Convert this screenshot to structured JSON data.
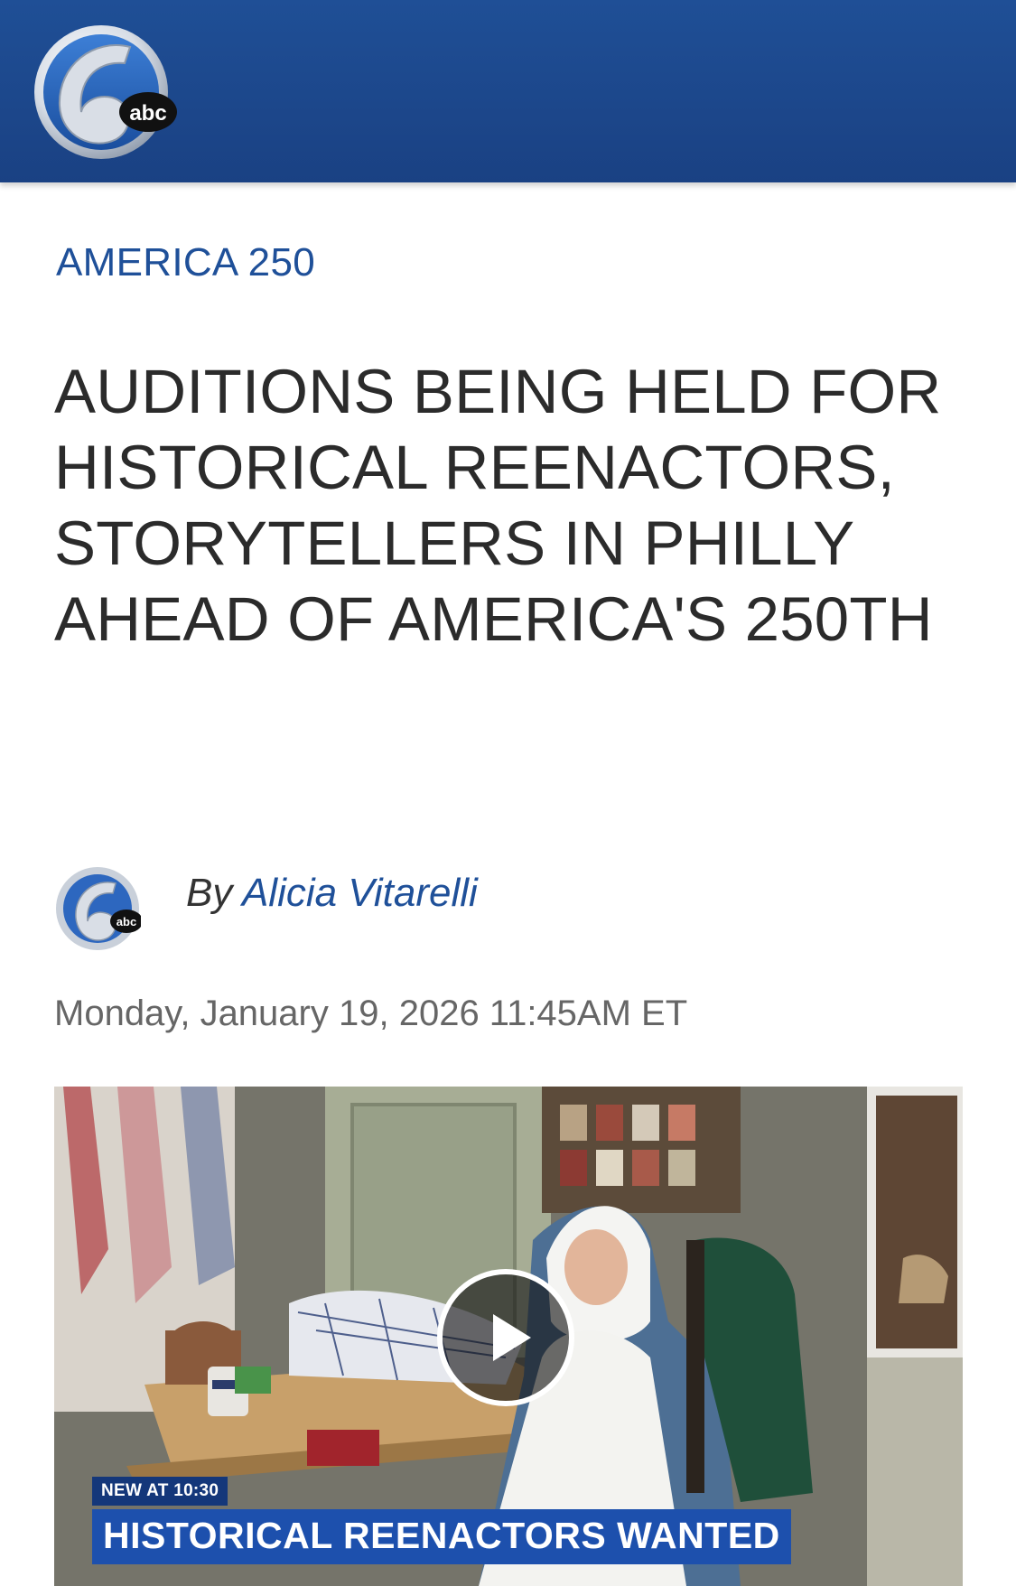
{
  "header": {
    "logo_text": "abc",
    "logo_number": "6"
  },
  "article": {
    "category": "AMERICA 250",
    "headline": "AUDITIONS BEING HELD FOR HISTORICAL REENACTORS, STORYTELLERS IN PHILLY AHEAD OF AMERICA'S 250TH",
    "byline_prefix": "By",
    "author": "Alicia Vitarelli",
    "timestamp": "Monday, January 19, 2026 11:45AM ET"
  },
  "video": {
    "tag": "NEW AT 10:30",
    "title": "HISTORICAL REENACTORS WANTED",
    "play_icon": "play-icon"
  },
  "colors": {
    "brand_blue": "#1f5099",
    "header_bg": "#1f4f96",
    "lower_third_blue": "#1d50ad"
  }
}
